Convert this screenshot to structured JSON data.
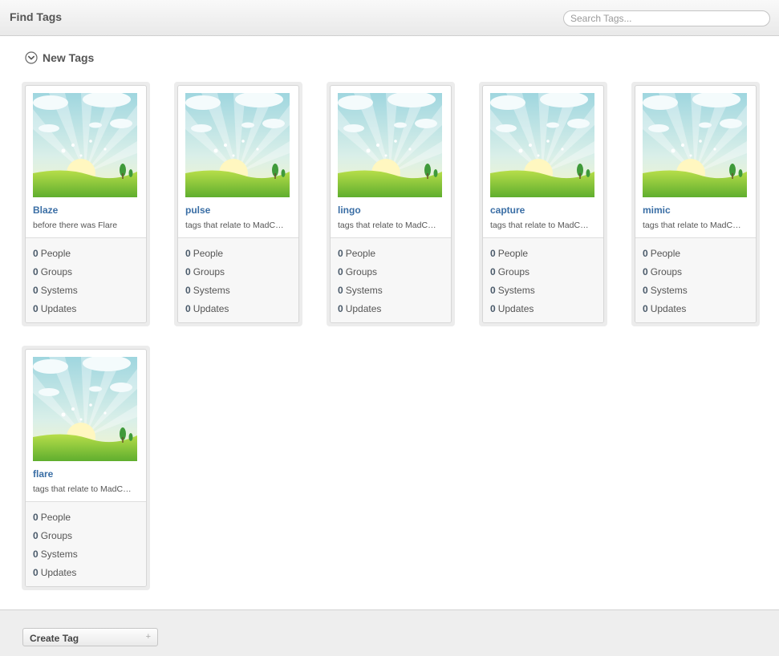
{
  "header": {
    "title": "Find Tags"
  },
  "search": {
    "placeholder": "Search Tags..."
  },
  "section": {
    "title": "New Tags"
  },
  "stat_labels": {
    "people": "People",
    "groups": "Groups",
    "systems": "Systems",
    "updates": "Updates"
  },
  "tags": [
    {
      "name": "Blaze",
      "description": "before there was Flare",
      "image": "meadow-sunrise-image",
      "people": "0",
      "groups": "0",
      "systems": "0",
      "updates": "0"
    },
    {
      "name": "pulse",
      "description": "tags that relate to MadCa...",
      "image": "meadow-sunrise-image",
      "people": "0",
      "groups": "0",
      "systems": "0",
      "updates": "0"
    },
    {
      "name": "lingo",
      "description": "tags that relate to MadCa...",
      "image": "meadow-sunrise-image",
      "people": "0",
      "groups": "0",
      "systems": "0",
      "updates": "0"
    },
    {
      "name": "capture",
      "description": "tags that relate to MadCa...",
      "image": "meadow-sunrise-image",
      "people": "0",
      "groups": "0",
      "systems": "0",
      "updates": "0"
    },
    {
      "name": "mimic",
      "description": "tags that relate to MadCa...",
      "image": "meadow-sunrise-image",
      "people": "0",
      "groups": "0",
      "systems": "0",
      "updates": "0"
    },
    {
      "name": "flare",
      "description": "tags that relate to MadCa...",
      "image": "meadow-sunrise-image",
      "people": "0",
      "groups": "0",
      "systems": "0",
      "updates": "0"
    }
  ],
  "footer": {
    "create_label": "Create Tag",
    "create_icon": "plus-icon"
  },
  "colors": {
    "link": "#3a6ea5",
    "header_bg": "#efefef",
    "footer_bg": "#eeeeee"
  }
}
